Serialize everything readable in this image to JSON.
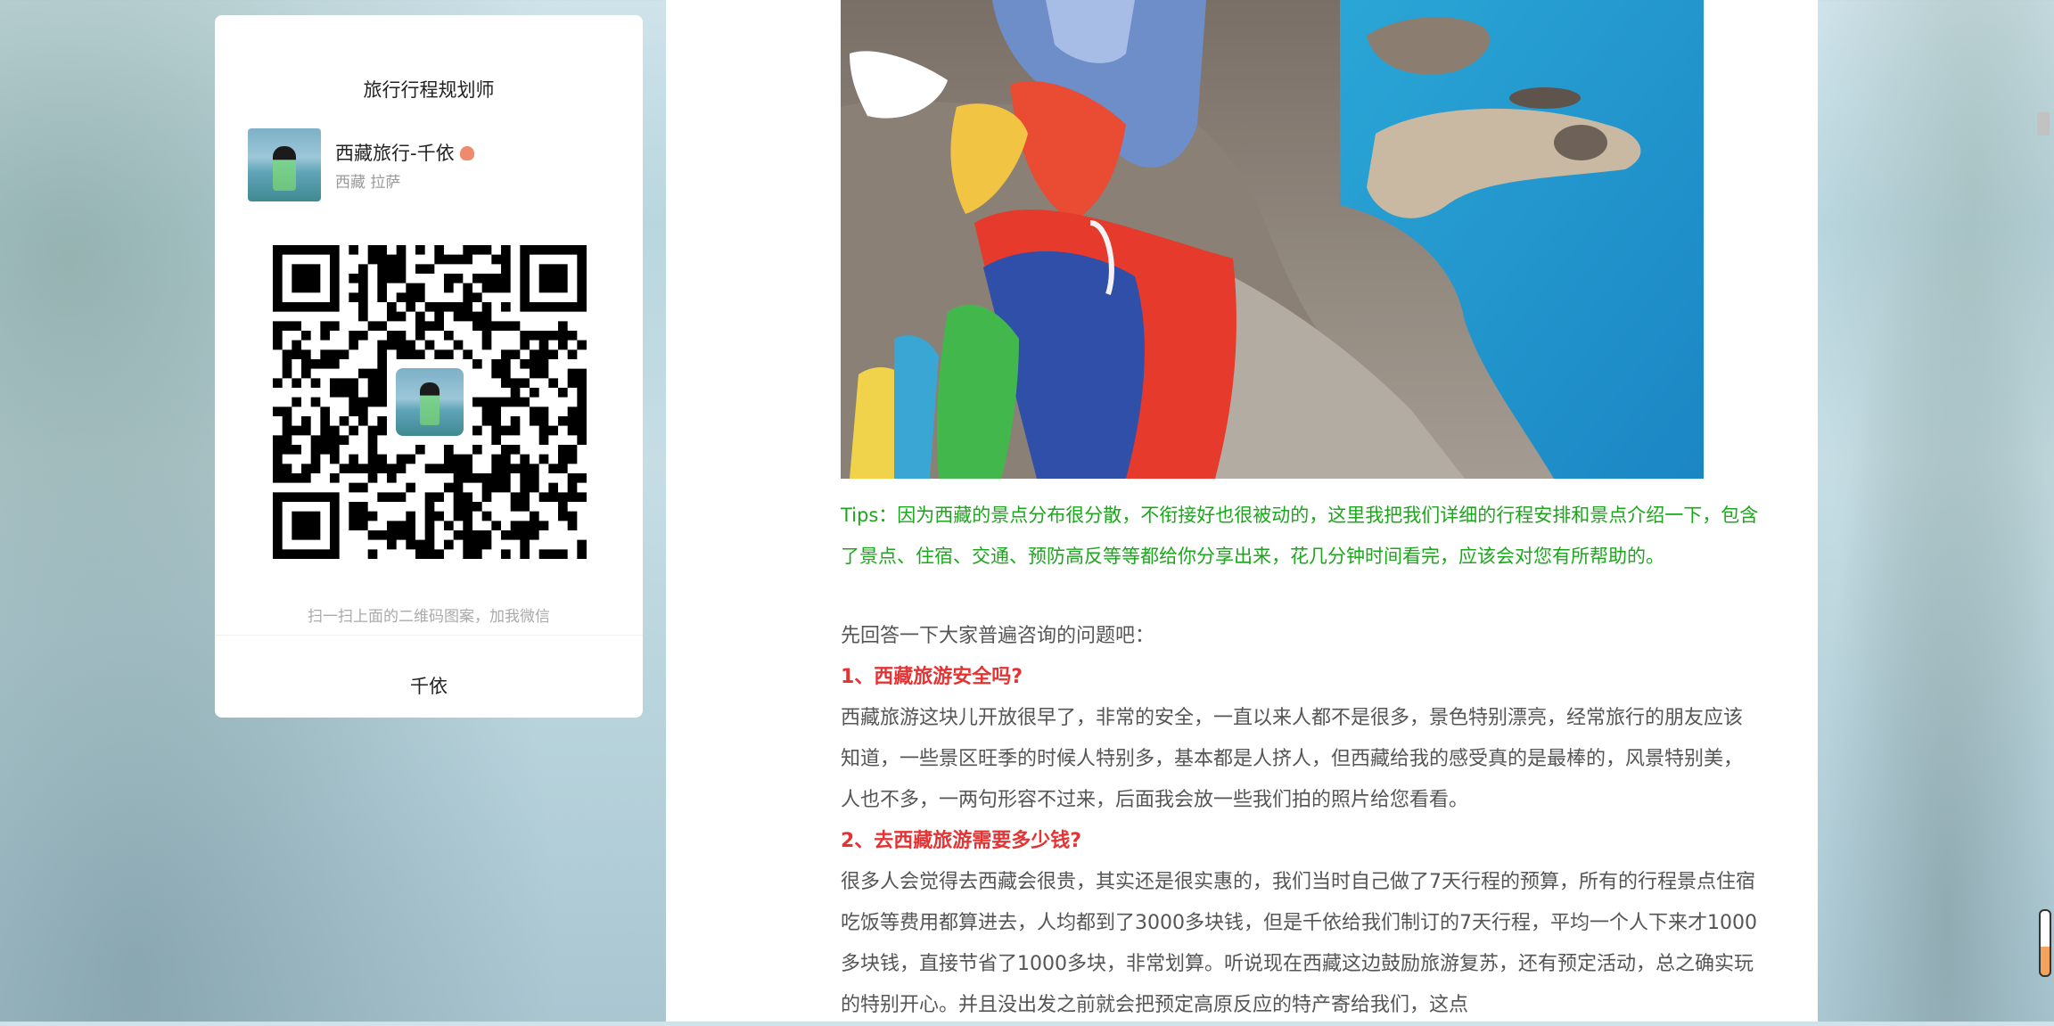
{
  "card": {
    "title": "旅行行程规划师",
    "profile_name": "西藏旅行-千依",
    "profile_location": "西藏 拉萨",
    "qr_hint": "扫一扫上面的二维码图案，加我微信",
    "footer_name": "千依"
  },
  "article": {
    "tips": "Tips：因为西藏的景点分布很分散，不衔接好也很被动的，这里我把我们详细的行程安排和景点介绍一下，包含了景点、住宿、交通、预防高反等等都给你分享出来，花几分钟时间看完，应该会对您有所帮助的。",
    "intro": "先回答一下大家普遍咨询的问题吧：",
    "q1_heading": "1、西藏旅游安全吗?",
    "q1_answer": "西藏旅游这块儿开放很早了，非常的安全，一直以来人都不是很多，景色特别漂亮，经常旅行的朋友应该知道，一些景区旺季的时候人特别多，基本都是人挤人，但西藏给我的感受真的是最棒的，风景特别美，人也不多，一两句形容不过来，后面我会放一些我们拍的照片给您看看。",
    "q2_heading": "2、去西藏旅游需要多少钱?",
    "q2_answer": "很多人会觉得去西藏会很贵，其实还是很实惠的，我们当时自己做了7天行程的预算，所有的行程景点住宿吃饭等费用都算进去，人均都到了3000多块钱，但是千依给我们制订的7天行程，平均一个人下来才1000多块钱，直接节省了1000多块，非常划算。听说现在西藏这边鼓励旅游复苏，还有预定活动，总之确实玩的特别开心。并且没出发之前就会把预定高原反应的特产寄给我们，这点"
  },
  "colors": {
    "tips_green": "#1ea51e",
    "heading_red": "#e53333",
    "body_text": "#555555"
  },
  "icons": {
    "name_badge": "person-emoji-icon",
    "qr": "qr-code",
    "scroll": "scroll-indicator-icon"
  }
}
